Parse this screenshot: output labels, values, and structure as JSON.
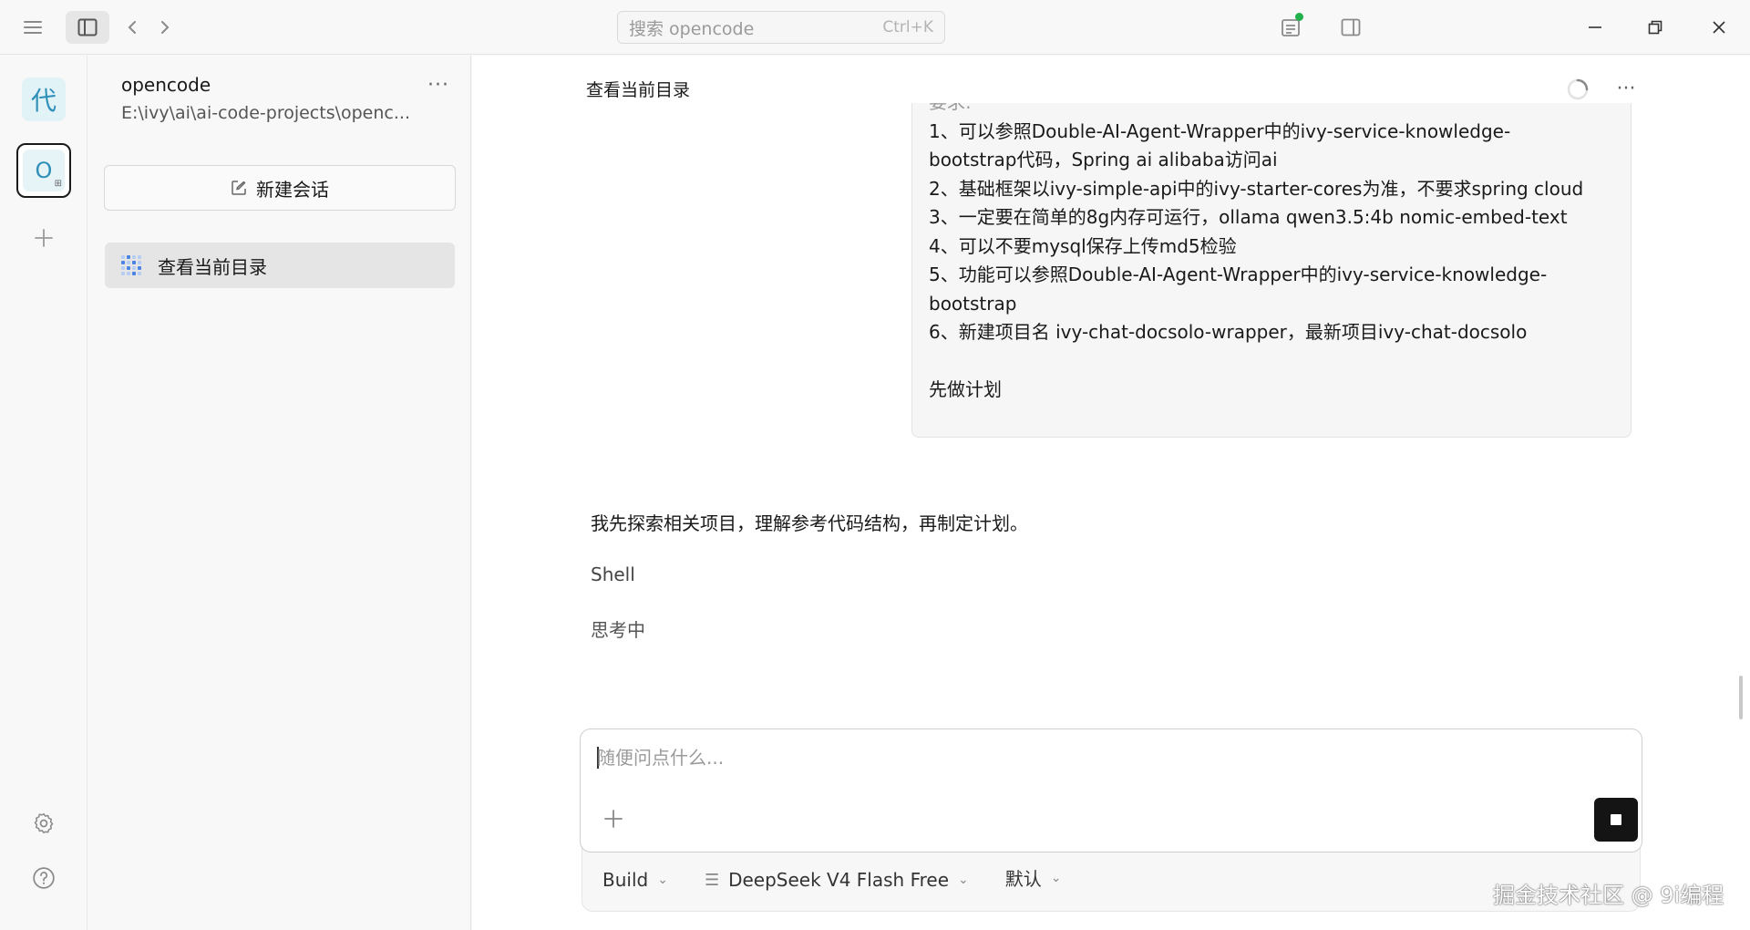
{
  "titlebar": {
    "search_placeholder": "搜索 opencode",
    "search_shortcut": "Ctrl+K"
  },
  "rail": {
    "workspace_avatar": "代",
    "project_avatar": "O",
    "project_avatar_sub": "⊞"
  },
  "project": {
    "name": "opencode",
    "path": "E:\\ivy\\ai\\ai-code-projects\\openc..."
  },
  "sessions": {
    "new_label": "新建会话",
    "items": [
      {
        "label": "查看当前目录"
      }
    ]
  },
  "chat": {
    "title": "查看当前目录",
    "user_message_lines": [
      "要求:",
      "1、可以参照Double-AI-Agent-Wrapper中的ivy-service-knowledge-",
      "bootstrap代码，Spring ai alibaba访问ai",
      "2、基础框架以ivy-simple-api中的ivy-starter-cores为准，不要求spring cloud",
      "3、一定要在简单的8g内存可运行，ollama qwen3.5:4b nomic-embed-text",
      "4、可以不要mysql保存上传md5检验",
      "5、功能可以参照Double-AI-Agent-Wrapper中的ivy-service-knowledge-",
      "bootstrap",
      "6、新建项目名  ivy-chat-docsolo-wrapper，最新项目ivy-chat-docsolo",
      "",
      "先做计划"
    ],
    "assistant_text": "我先探索相关项目，理解参考代码结构，再制定计划。",
    "tool_label": "Shell",
    "status": "思考中"
  },
  "composer": {
    "placeholder": "随便问点什么...",
    "value": ""
  },
  "footer": {
    "agent": "Build",
    "model": "DeepSeek V4 Flash Free",
    "variant": "默认"
  },
  "watermark": "掘金技术社区 @ 9i编程",
  "colors": {
    "accent_blue": "#4a82e6",
    "online_dot": "#21b04b",
    "stop_button": "#141414"
  }
}
